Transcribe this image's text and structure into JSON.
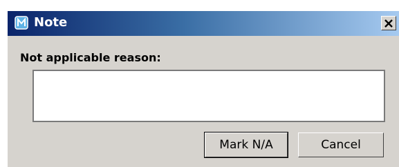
{
  "window": {
    "title": "Note",
    "close_glyph": "✕",
    "icon": "note-app-icon"
  },
  "form": {
    "reason_label": "Not applicable reason:",
    "reason_value": "",
    "reason_placeholder": ""
  },
  "buttons": {
    "mark_na_label": "Mark N/A",
    "cancel_label": "Cancel"
  },
  "colors": {
    "titlebar_start": "#0a246a",
    "titlebar_end": "#a6caf0",
    "dialog_bg": "#d6d3ce"
  }
}
